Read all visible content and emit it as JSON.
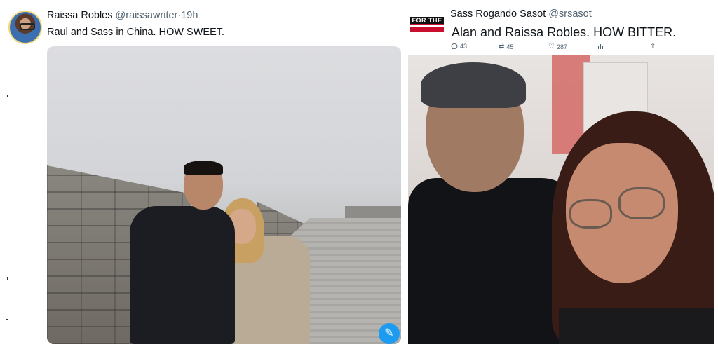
{
  "left_tweet": {
    "author_name": "Raissa Robles",
    "handle": "@raissawriter",
    "time": "19h",
    "text": "Raul and Sass in China. HOW SWEET."
  },
  "right_tweet": {
    "logo_text": "FOR THE",
    "author_name": "Sass Rogando Sasot",
    "handle": "@srsasot",
    "text": "Alan and Raissa Robles.  HOW BITTER.",
    "actions": {
      "replies": "43",
      "retweets": "45",
      "likes": "287"
    }
  },
  "icons": {
    "reply": "reply-icon",
    "retweet": "retweet-icon",
    "like": "heart-icon",
    "views": "analytics-icon",
    "share": "share-icon",
    "badge": "feather-compose-icon"
  },
  "colors": {
    "accent": "#1d9bf0",
    "secondary_text": "#536471",
    "logo_red": "#c8102e"
  }
}
